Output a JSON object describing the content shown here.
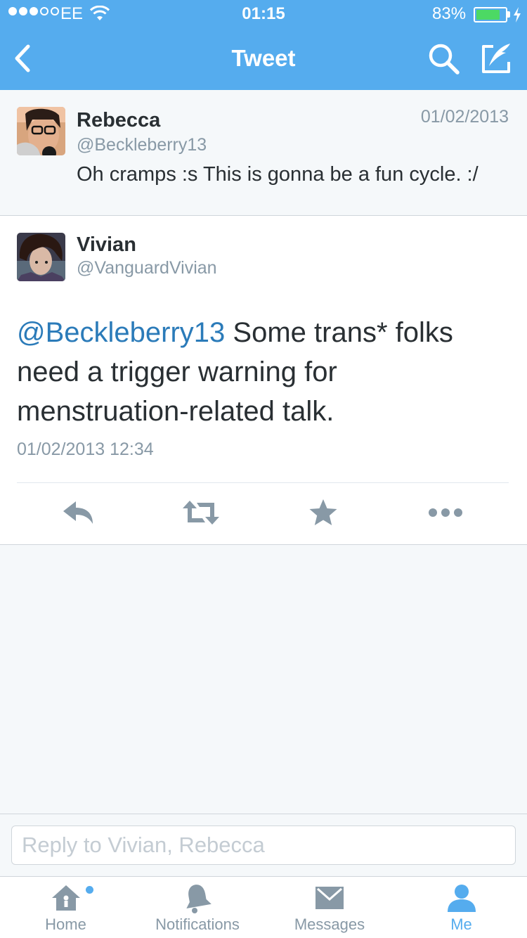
{
  "status_bar": {
    "carrier": "EE",
    "time": "01:15",
    "battery_percent": "83%",
    "battery_level": 0.83
  },
  "nav": {
    "title": "Tweet"
  },
  "parent_tweet": {
    "name": "Rebecca",
    "handle": "@Beckleberry13",
    "date": "01/02/2013",
    "text": "Oh cramps :s This is gonna be a fun cycle. :/"
  },
  "main_tweet": {
    "name": "Vivian",
    "handle": "@VanguardVivian",
    "mention": "@Beckleberry13",
    "text": " Some trans* folks need a trigger warning for menstruation-related talk.",
    "timestamp": "01/02/2013 12:34"
  },
  "actions": {
    "reply_icon": "reply-icon",
    "retweet_icon": "retweet-icon",
    "favorite_icon": "star-icon",
    "more_icon": "more-icon"
  },
  "reply": {
    "placeholder": "Reply to Vivian, Rebecca"
  },
  "tabs": [
    {
      "label": "Home",
      "icon": "home-icon"
    },
    {
      "label": "Notifications",
      "icon": "bell-icon"
    },
    {
      "label": "Messages",
      "icon": "envelope-icon"
    },
    {
      "label": "Me",
      "icon": "person-icon"
    }
  ],
  "colors": {
    "brand": "#55acee",
    "link": "#2b7bb9",
    "muted": "#8899a6",
    "text": "#292f33",
    "background": "#f5f8fa"
  }
}
